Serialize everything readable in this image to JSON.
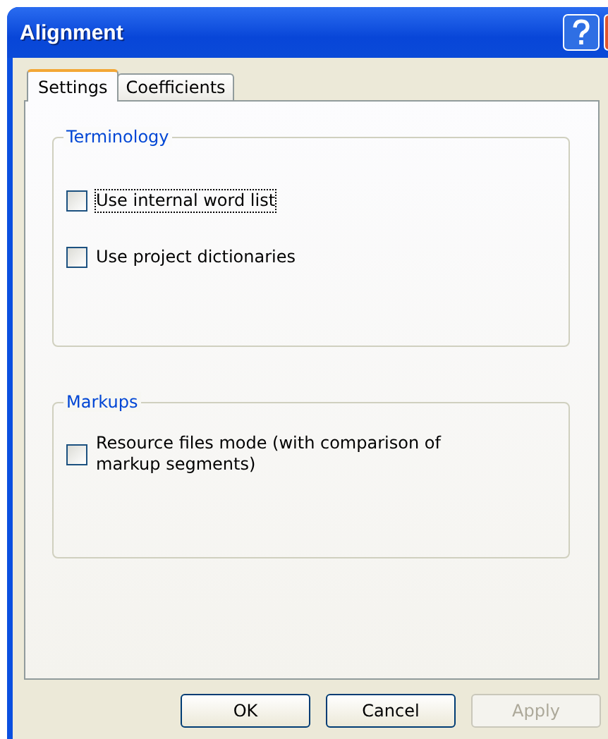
{
  "window": {
    "title": "Alignment"
  },
  "tabs": [
    {
      "label": "Settings",
      "selected": true
    },
    {
      "label": "Coefficients",
      "selected": false
    }
  ],
  "groups": [
    {
      "title": "Terminology",
      "options": [
        {
          "label": "Use internal word list",
          "checked": false,
          "focused": true
        },
        {
          "label": "Use project dictionaries",
          "checked": false,
          "focused": false
        }
      ]
    },
    {
      "title": "Markups",
      "options": [
        {
          "label": "Resource files mode (with comparison of markup segments)",
          "checked": false,
          "focused": false
        }
      ]
    }
  ],
  "buttons": [
    {
      "label": "OK",
      "disabled": false
    },
    {
      "label": "Cancel",
      "disabled": false
    },
    {
      "label": "Apply",
      "disabled": true
    }
  ]
}
